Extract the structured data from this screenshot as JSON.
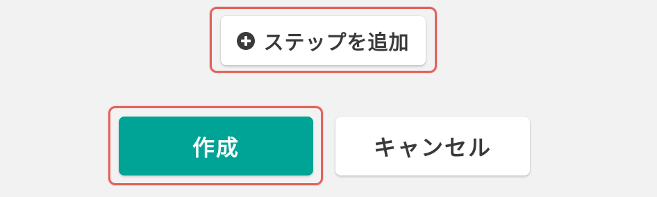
{
  "add_step": {
    "label": "ステップを追加",
    "icon": "plus-circle-icon"
  },
  "actions": {
    "create_label": "作成",
    "cancel_label": "キャンセル"
  },
  "colors": {
    "background": "#f2f2f2",
    "primary": "#00a497",
    "highlight": "#e2635c",
    "text_dark": "#3a3a3a"
  }
}
